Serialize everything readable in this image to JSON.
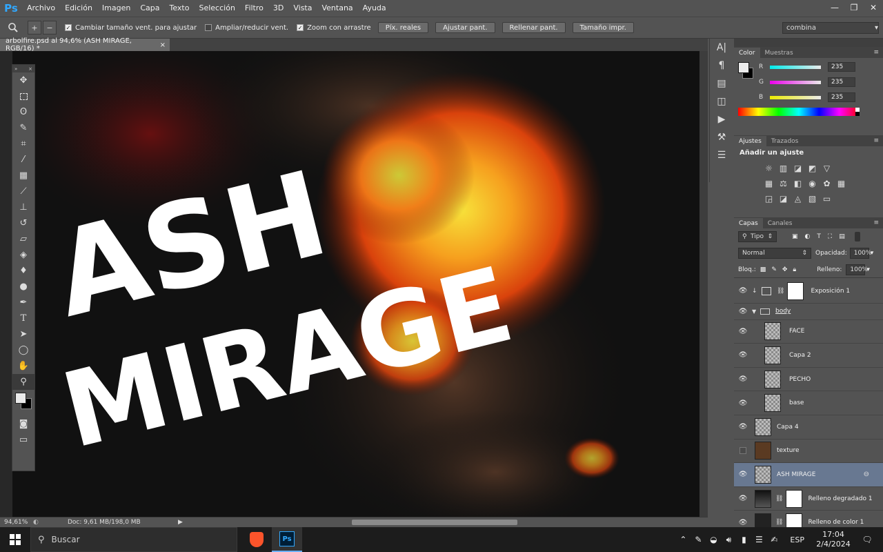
{
  "app": {
    "logo": "Ps"
  },
  "menu": [
    "Archivo",
    "Edición",
    "Imagen",
    "Capa",
    "Texto",
    "Selección",
    "Filtro",
    "3D",
    "Vista",
    "Ventana",
    "Ayuda"
  ],
  "window_controls": {
    "minimize": "—",
    "restore": "❐",
    "close": "✕"
  },
  "options": {
    "tool_icon": "zoom-icon",
    "zoom_in": "+",
    "zoom_out": "−",
    "checkboxes": [
      {
        "label": "Cambiar tamaño vent. para ajustar",
        "checked": true
      },
      {
        "label": "Ampliar/reducir vent.",
        "checked": false
      },
      {
        "label": "Zoom con arrastre",
        "checked": true
      }
    ],
    "buttons": [
      "Píx. reales",
      "Ajustar pant.",
      "Rellenar pant.",
      "Tamaño impr."
    ],
    "workspace": "combina"
  },
  "document": {
    "tab_title": "arbolfire.psd al 94,6% (ASH MIRAGE, RGB/16) *",
    "close": "×",
    "art_text_line1": "ASH",
    "art_text_line2": "MIRAGE"
  },
  "toolbox": {
    "header_left": "»",
    "header_right": "×"
  },
  "status": {
    "zoom": "94,61%",
    "doc": "Doc: 9,61 MB/198,0 MB"
  },
  "color_panel": {
    "tabs": [
      "Color",
      "Muestras"
    ],
    "channels": [
      {
        "label": "R",
        "value": "235"
      },
      {
        "label": "G",
        "value": "235"
      },
      {
        "label": "B",
        "value": "235"
      }
    ]
  },
  "adjust_panel": {
    "tabs": [
      "Ajustes",
      "Trazados"
    ],
    "title": "Añadir un ajuste"
  },
  "layers_panel": {
    "tabs": [
      "Capas",
      "Canales"
    ],
    "filter": "Tipo",
    "blend_mode": "Normal",
    "opacity_label": "Opacidad:",
    "opacity": "100%",
    "lock_label": "Bloq.:",
    "fill_label": "Relleno:",
    "fill": "100%",
    "layers": [
      {
        "name": "Exposición 1",
        "visible": true,
        "kind": "adjust"
      },
      {
        "name": "body",
        "visible": true,
        "kind": "group"
      },
      {
        "name": "FACE",
        "visible": true,
        "kind": "child"
      },
      {
        "name": "Capa 2",
        "visible": true,
        "kind": "child"
      },
      {
        "name": "PECHO",
        "visible": true,
        "kind": "child"
      },
      {
        "name": "base",
        "visible": true,
        "kind": "child"
      },
      {
        "name": "Capa 4",
        "visible": true,
        "kind": "normal"
      },
      {
        "name": "texture",
        "visible": false,
        "kind": "normal"
      },
      {
        "name": "ASH MIRAGE",
        "visible": true,
        "kind": "selected"
      },
      {
        "name": "Relleno degradado 1",
        "visible": true,
        "kind": "fill"
      },
      {
        "name": "Relleno de color 1",
        "visible": true,
        "kind": "fill"
      }
    ]
  },
  "taskbar": {
    "search_placeholder": "Buscar",
    "language": "ESP",
    "time": "17:04",
    "date": "2/4/2024"
  }
}
